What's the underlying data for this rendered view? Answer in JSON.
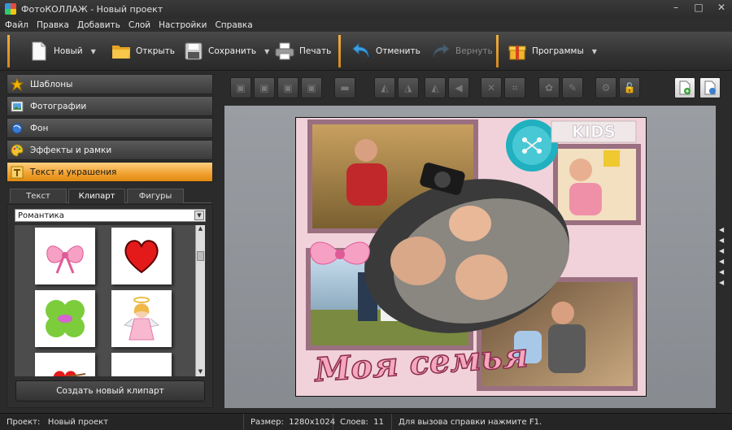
{
  "window": {
    "title": "ФотоКОЛЛАЖ - Новый проект",
    "controls": [
      "–",
      "□",
      "✕"
    ]
  },
  "menu": [
    "Файл",
    "Правка",
    "Добавить",
    "Слой",
    "Настройки",
    "Справка"
  ],
  "toolbar": {
    "new_label": "Новый",
    "open_label": "Открыть",
    "save_label": "Сохранить",
    "print_label": "Печать",
    "undo_label": "Отменить",
    "redo_label": "Вернуть",
    "programs_label": "Программы"
  },
  "sidebar": {
    "items": [
      {
        "label": "Шаблоны",
        "icon": "star-icon"
      },
      {
        "label": "Фотографии",
        "icon": "photos-icon"
      },
      {
        "label": "Фон",
        "icon": "background-icon"
      },
      {
        "label": "Эффекты и рамки",
        "icon": "palette-icon"
      },
      {
        "label": "Текст и украшения",
        "icon": "text-icon",
        "active": true
      }
    ],
    "tabs": [
      "Текст",
      "Клипарт",
      "Фигуры"
    ],
    "active_tab": "Клипарт",
    "category_value": "Романтика",
    "create_button": "Создать новый клипарт"
  },
  "canvas": {
    "badge_text": "KIDS",
    "caption": "Моя семья"
  },
  "status": {
    "project_label": "Проект:",
    "project_value": "Новый проект",
    "size_label": "Размер:",
    "size_value": "1280x1024",
    "layers_label": "Слоев:",
    "layers_value": "11",
    "help_text": "Для вызова справки нажмите F1."
  },
  "colors": {
    "accent": "#f0a030",
    "canvas_bg": "#8f9398"
  }
}
